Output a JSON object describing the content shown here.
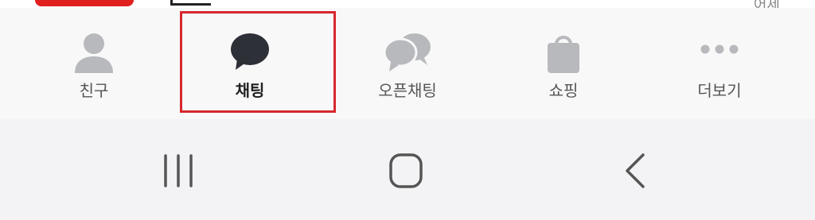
{
  "top": {
    "time": "어제"
  },
  "tabs": [
    {
      "label": "친구",
      "icon": "person-icon",
      "active": false
    },
    {
      "label": "채팅",
      "icon": "chat-bubble-icon",
      "active": true
    },
    {
      "label": "오픈채팅",
      "icon": "open-chat-icon",
      "active": false
    },
    {
      "label": "쇼핑",
      "icon": "shopping-bag-icon",
      "active": false
    },
    {
      "label": "더보기",
      "icon": "more-dots-icon",
      "active": false
    }
  ],
  "navbar": {
    "buttons": [
      "recent-apps-icon",
      "home-icon",
      "back-icon"
    ]
  },
  "colors": {
    "active_icon": "#2e3037",
    "inactive_icon": "#b8b9bd",
    "highlight": "#d7272d"
  }
}
